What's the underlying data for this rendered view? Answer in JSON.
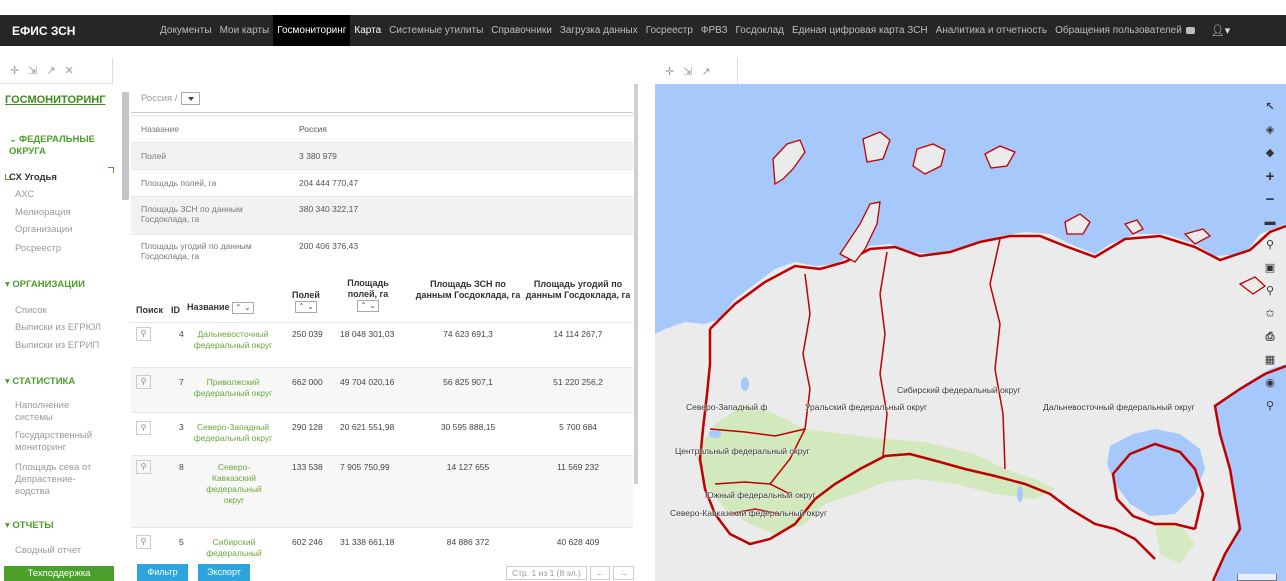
{
  "brand": "ЕФИС ЗСН",
  "nav": [
    "Документы",
    "Мои карты",
    "Госмониторинг",
    "Карта",
    "Системные утилиты",
    "Справочники",
    "Загрузка данных",
    "Госреестр",
    "ФРВЗ",
    "Госдоклад",
    "Единая цифровая карта ЗСН",
    "Аналитика и отчетность",
    "Обращения пользователей"
  ],
  "nav_active": "Госмониторинг",
  "sidebar": {
    "title": "ГОСМОНИТОРИНГ",
    "sections": [
      {
        "title": "ФЕДЕРАЛЬНЫЕ ОКРУГА",
        "items": [
          "СХ Угодья",
          "АХС",
          "Мелиорация",
          "Организации",
          "Росреестр"
        ]
      },
      {
        "title": "ОРГАНИЗАЦИИ",
        "items": [
          "Список",
          "Выписки из ЕГРЮЛ",
          "Выписки из ЕГРИП"
        ]
      },
      {
        "title": "СТАТИСТИКА",
        "items": [
          "Наполнение системы",
          "Государственный мониторинг",
          "Площадь сева от Депрастение-водства"
        ]
      },
      {
        "title": "ОТЧЕТЫ",
        "items": [
          "Сводный отчет"
        ]
      }
    ],
    "support_button": "Техподдержка"
  },
  "breadcrumb": {
    "root": "Россия",
    "sep": "/"
  },
  "info": [
    {
      "k": "Название",
      "v": "Россия"
    },
    {
      "k": "Полей",
      "v": "3 380 979"
    },
    {
      "k": "Площадь полей, га",
      "v": "204 444 770,47"
    },
    {
      "k": "Площадь ЗСН по данным Госдоклада, га",
      "v": "380 340 322,17"
    },
    {
      "k": "Площадь угодий по данным Госдоклада, га",
      "v": "200 406 376,43"
    }
  ],
  "table": {
    "headers": [
      "Поиск",
      "ID",
      "Название",
      "Полей",
      "Площадь полей, га",
      "Площадь ЗСН по данным Госдоклада, га",
      "Площадь угодий по данным Госдоклада, га"
    ],
    "rows": [
      {
        "id": "4",
        "name": "Дальневосточный федеральный округ",
        "fields": "250 039",
        "area": "18 048 301,03",
        "zsn": "74 623 691,3",
        "ugod": "14 114 267,7"
      },
      {
        "id": "7",
        "name": "Приволжский федеральный округ",
        "fields": "662 000",
        "area": "49 704 020,16",
        "zsn": "56 825 907,1",
        "ugod": "51 220 256,2"
      },
      {
        "id": "3",
        "name": "Северо-Западный федеральный округ",
        "fields": "290 128",
        "area": "20 621 551,98",
        "zsn": "30 595 888,15",
        "ugod": "5 700 684"
      },
      {
        "id": "8",
        "name": "Северо-Кавказский федеральный округ",
        "fields": "133 538",
        "area": "7 905 750,99",
        "zsn": "14 127 655",
        "ugod": "11 569 232"
      },
      {
        "id": "5",
        "name": "Сибирский федеральный",
        "fields": "602 246",
        "area": "31 338 661,18",
        "zsn": "84 886 372",
        "ugod": "40 628 409"
      }
    ]
  },
  "buttons": {
    "filter": "Фильтр",
    "export": "Экспорт"
  },
  "pager": {
    "text": "Стр. 1 из 1 (8 эл.)",
    "prev": "←",
    "next": "→"
  },
  "map_labels": [
    "Сибирский федеральный округ",
    "Северо-Западный ф",
    "Уральский федеральный округ",
    "Дальневосточный федеральный округ",
    "Центральный федеральный округ",
    "Южный федеральный округ",
    "Северо-Кавказский федеральный округ"
  ],
  "colors": {
    "brand_green": "#4aa02a",
    "link_green": "#6aa83a",
    "button_blue": "#2ea4dc",
    "nav_bg": "#262626",
    "sea": "#a7c8fb",
    "land": "#ebebeb",
    "agri": "#cfe8b8",
    "border": "#c00000"
  }
}
